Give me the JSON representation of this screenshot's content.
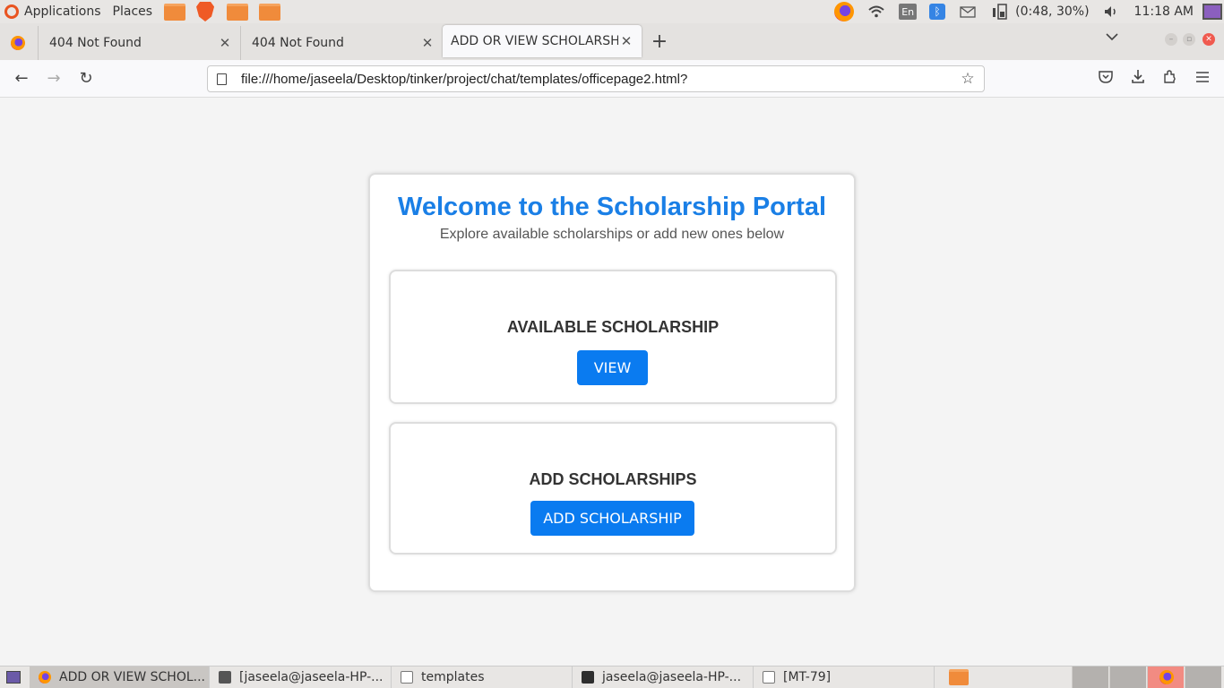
{
  "system_panel": {
    "applications_label": "Applications",
    "places_label": "Places",
    "keyboard_layout": "En",
    "battery_text": "(0:48, 30%)",
    "clock": "11:18 AM"
  },
  "tabs": [
    {
      "title": "404 Not Found"
    },
    {
      "title": "404 Not Found"
    },
    {
      "title": "ADD OR VIEW SCHOLARSHIP"
    }
  ],
  "navbar": {
    "url": "file:///home/jaseela/Desktop/tinker/project/chat/templates/officepage2.html?"
  },
  "page": {
    "title": "Welcome to the Scholarship Portal",
    "subtitle": "Explore available scholarships or add new ones below",
    "sections": [
      {
        "heading": "AVAILABLE SCHOLARSHIP",
        "button_label": "VIEW"
      },
      {
        "heading": "ADD SCHOLARSHIPS",
        "button_label": "ADD SCHOLARSHIP"
      }
    ]
  },
  "taskbar": {
    "items": [
      {
        "label": "ADD OR VIEW SCHOL..."
      },
      {
        "label": "[jaseela@jaseela-HP-..."
      },
      {
        "label": "templates"
      },
      {
        "label": "jaseela@jaseela-HP-..."
      },
      {
        "label": "[MT-79]"
      }
    ]
  },
  "colors": {
    "accent": "#1a7fe6",
    "button": "#0a7bf0",
    "page_background": "#f4f4f4"
  }
}
